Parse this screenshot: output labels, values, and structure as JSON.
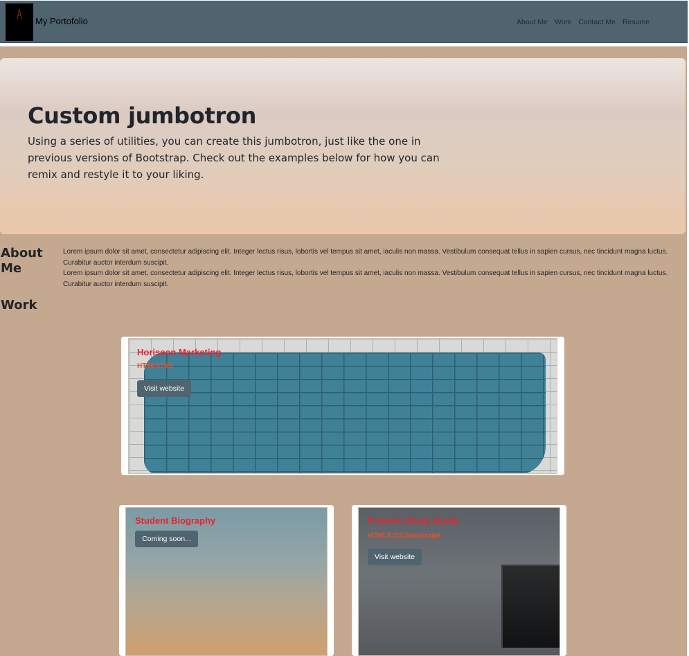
{
  "navbar": {
    "brand": "My Portofolio",
    "links": [
      "About Me",
      "Work",
      "Contact Me",
      "Resume"
    ]
  },
  "jumbotron": {
    "title": "Custom jumbotron",
    "text": "Using a series of utilities, you can create this jumbotron, just like the one in previous versions of Bootstrap. Check out the examples below for how you can remix and restyle it to your liking."
  },
  "about": {
    "heading": "About Me",
    "paragraph1": "Lorem ipsum dolor sit amet, consectetur adipiscing elit. Integer lectus risus, lobortis vel tempus sit amet, iaculis non massa. Vestibulum consequat tellus in sapien cursus, nec tincidunt magna luctus. Curabitur auctor interdum suscipit.",
    "paragraph2": "Lorem ipsum dolor sit amet, consectetur adipiscing elit. Integer lectus risus, lobortis vel tempus sit amet, iaculis non massa. Vestibulum consequat tellus in sapien cursus, nec tincidunt magna luctus. Curabitur auctor interdum suscipit."
  },
  "work": {
    "heading": "Work",
    "projects": [
      {
        "title": "Horiseon Marketing",
        "subtitle": "HTML/CSS",
        "button": "Visit website"
      },
      {
        "title": "Student Biography",
        "subtitle": "",
        "button": "Coming soon..."
      },
      {
        "title": "Prework Study Guide",
        "subtitle": "HTML/CSS/JavaScript",
        "button": "Visit website"
      }
    ]
  },
  "colors": {
    "navbar": "#4f646f",
    "background": "#c4a88f",
    "title_accent": "#e8232f",
    "subtitle_accent": "#e8502a",
    "button": "#4f646f"
  }
}
